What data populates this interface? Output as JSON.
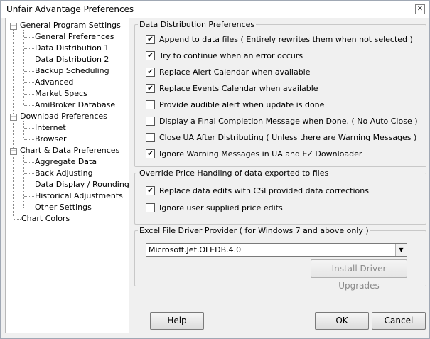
{
  "window": {
    "title": "Unfair Advantage Preferences",
    "close_glyph": "✕"
  },
  "tree": {
    "groups": [
      {
        "label": "General Program Settings",
        "items": [
          "General Preferences",
          "Data Distribution 1",
          "Data Distribution 2",
          "Backup Scheduling",
          "Advanced",
          "Market Specs",
          "AmiBroker Database"
        ]
      },
      {
        "label": "Download Preferences",
        "items": [
          "Internet",
          "Browser"
        ]
      },
      {
        "label": "Chart & Data Preferences",
        "items": [
          "Aggregate Data",
          "Back Adjusting",
          "Data Display / Rounding",
          "Historical Adjustments",
          "Other Settings"
        ]
      }
    ],
    "extra": "Chart Colors",
    "expander_glyph": "−",
    "selected": "Data Distribution 1"
  },
  "distribution": {
    "title": "Data Distribution Preferences",
    "options": [
      {
        "label": "Append to data files ( Entirely rewrites them when not selected )",
        "checked": true
      },
      {
        "label": "Try to continue when an error occurs",
        "checked": true
      },
      {
        "label": "Replace Alert Calendar when available",
        "checked": true
      },
      {
        "label": "Replace Events Calendar when available",
        "checked": true
      },
      {
        "label": "Provide audible alert when update is done",
        "checked": false
      },
      {
        "label": "Display a Final Completion Message when Done. ( No Auto Close )",
        "checked": false
      },
      {
        "label": "Close UA After Distributing ( Unless there are Warning Messages )",
        "checked": false
      },
      {
        "label": "Ignore Warning Messages in UA and EZ Downloader",
        "checked": true
      }
    ]
  },
  "override": {
    "title": "Override Price Handling of data exported to files",
    "options": [
      {
        "label": "Replace data edits with CSI provided data corrections",
        "checked": true
      },
      {
        "label": "Ignore user supplied price edits",
        "checked": false
      }
    ]
  },
  "excel": {
    "title": "Excel File Driver Provider ( for Windows 7 and above only )",
    "selected": "Microsoft.Jet.OLEDB.4.0",
    "install_label": "Install Driver Upgrades"
  },
  "buttons": {
    "help": "Help",
    "ok": "OK",
    "cancel": "Cancel"
  },
  "check_glyph": "✔",
  "arrow_glyph": "▼"
}
